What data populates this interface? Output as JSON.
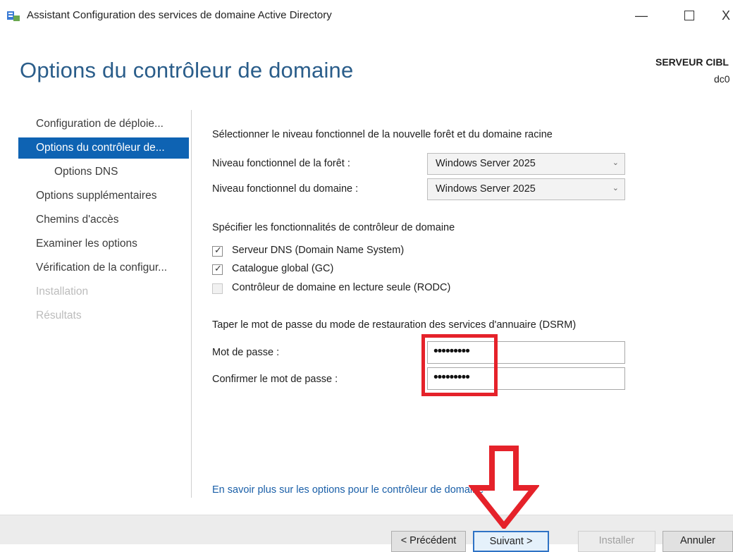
{
  "window": {
    "title": "Assistant Configuration des services de domaine Active Directory",
    "minimize_glyph": "—",
    "close_glyph": "X"
  },
  "header": {
    "heading": "Options du contrôleur de domaine",
    "target_label": "SERVEUR CIBL",
    "target_value": "dc0"
  },
  "sidebar": {
    "items": [
      {
        "label": "Configuration de déploie...",
        "state": "normal"
      },
      {
        "label": "Options du contrôleur de...",
        "state": "active"
      },
      {
        "label": "Options DNS",
        "state": "normal"
      },
      {
        "label": "Options supplémentaires",
        "state": "normal"
      },
      {
        "label": "Chemins d'accès",
        "state": "normal"
      },
      {
        "label": "Examiner les options",
        "state": "normal"
      },
      {
        "label": "Vérification de la configur...",
        "state": "normal"
      },
      {
        "label": "Installation",
        "state": "disabled"
      },
      {
        "label": "Résultats",
        "state": "disabled"
      }
    ]
  },
  "functional_level": {
    "section_label": "Sélectionner le niveau fonctionnel de la nouvelle forêt et du domaine racine",
    "forest_label": "Niveau fonctionnel de la forêt :",
    "forest_value": "Windows Server 2025",
    "domain_label": "Niveau fonctionnel du domaine :",
    "domain_value": "Windows Server 2025"
  },
  "capabilities": {
    "section_label": "Spécifier les fonctionnalités de contrôleur de domaine",
    "options": [
      {
        "label": "Serveur DNS (Domain Name System)",
        "checked": true,
        "enabled": true
      },
      {
        "label": "Catalogue global (GC)",
        "checked": true,
        "enabled": true
      },
      {
        "label": "Contrôleur de domaine en lecture seule (RODC)",
        "checked": false,
        "enabled": false
      }
    ]
  },
  "dsrm": {
    "section_label": "Taper le mot de passe du mode de restauration des services d'annuaire (DSRM)",
    "password_label": "Mot de passe :",
    "password_value": "•••••••••",
    "confirm_label": "Confirmer le mot de passe :",
    "confirm_value": "•••••••••"
  },
  "help_link": "En savoir plus sur les options pour le contrôleur de domaine",
  "footer": {
    "previous": "< Précédent",
    "next": "Suivant >",
    "install": "Installer",
    "cancel": "Annuler"
  },
  "colors": {
    "heading": "#2a5d8a",
    "nav_active": "#0e63b3",
    "link": "#1a5fa8",
    "annotation": "#e5222a"
  }
}
